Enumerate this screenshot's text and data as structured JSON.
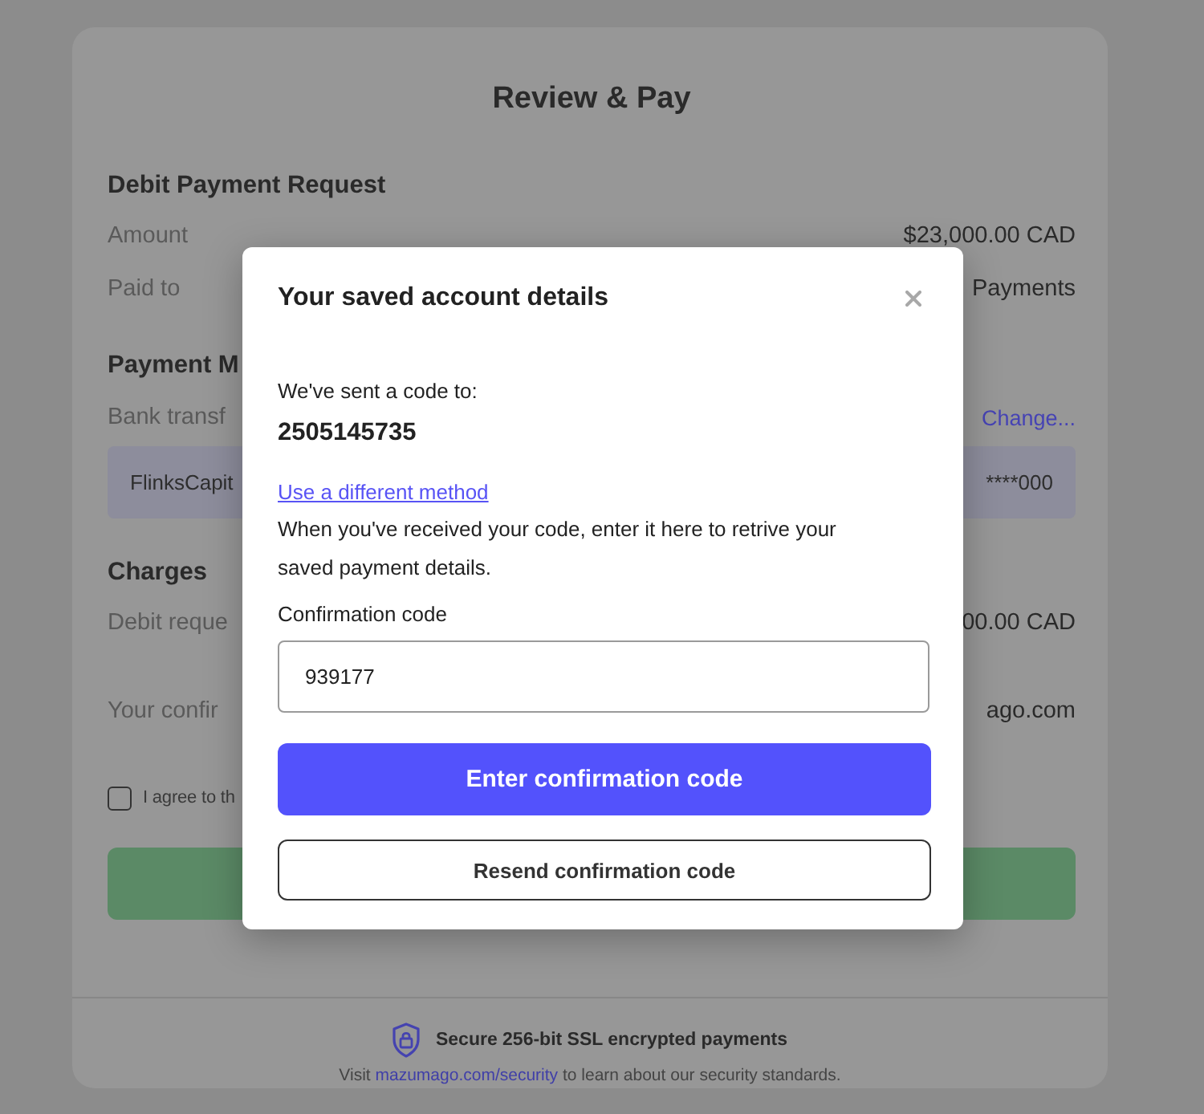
{
  "page": {
    "title": "Review & Pay"
  },
  "request": {
    "heading": "Debit Payment Request",
    "rows": [
      {
        "label": "Amount",
        "value": "$23,000.00 CAD"
      },
      {
        "label": "Paid to",
        "value": "Payments"
      }
    ]
  },
  "payment_method": {
    "heading": "Payment M",
    "label": "Bank transf",
    "change_link": "Change...",
    "account": {
      "name": "FlinksCapit",
      "number": "****000"
    }
  },
  "charges": {
    "heading": "Charges",
    "rows": [
      {
        "label": "Debit reque",
        "value": "00.00 CAD"
      },
      {
        "label": "Your confir",
        "value": "ago.com"
      }
    ]
  },
  "agreement": {
    "label": "I agree to th",
    "checked": false
  },
  "footer": {
    "secure_text": "Secure 256-bit SSL encrypted payments",
    "note": {
      "before": "Visit",
      "link": "mazumago.com/security",
      "after": "to learn about our security standards."
    }
  },
  "modal": {
    "title": "Your saved account details",
    "sent_text": "We've sent a code to:",
    "phone": "2505145735",
    "method_link": "Use a different method",
    "instructions": "When you've received your code, enter it here to retrive your saved payment details.",
    "code_field": {
      "label": "Confirmation code",
      "value": "939177"
    },
    "primary_button": "Enter confirmation code",
    "secondary_button": "Resend confirmation code"
  }
}
